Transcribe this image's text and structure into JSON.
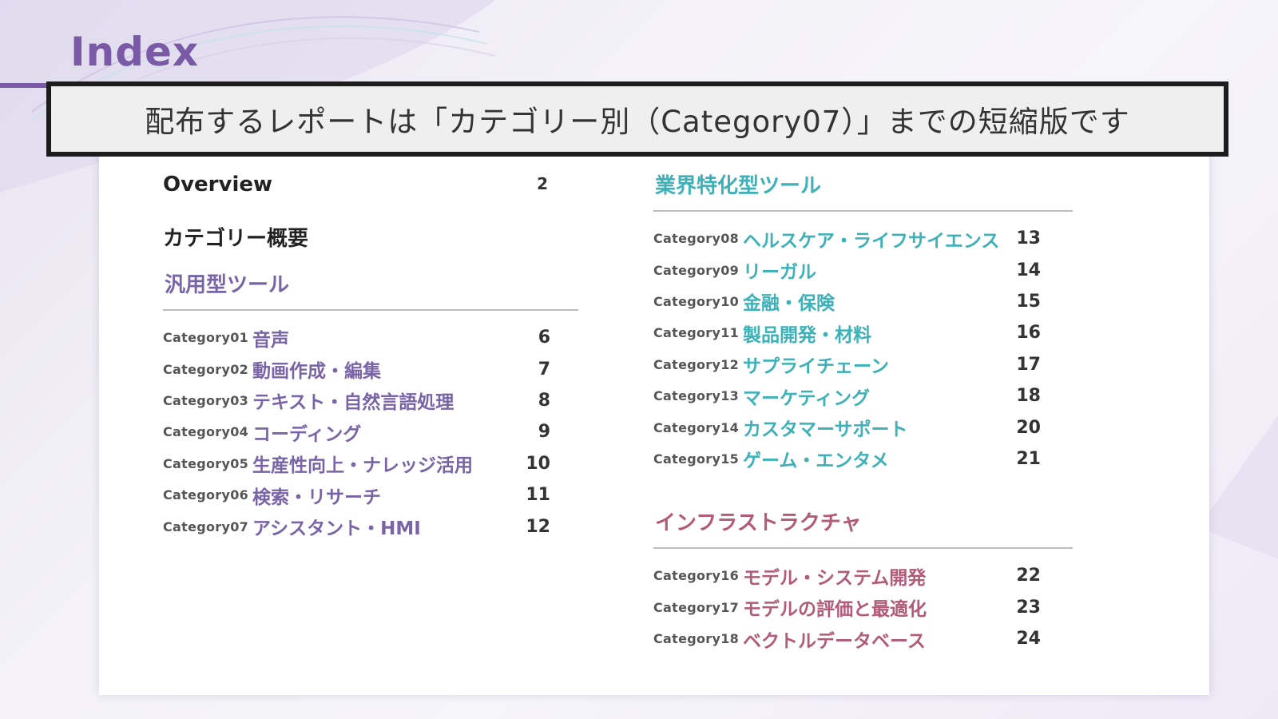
{
  "slide": {
    "title": "Index"
  },
  "notice": "配布するレポートは「カテゴリー別（Category07）」までの短縮版です",
  "colors": {
    "title": "#7a5aa6",
    "general": "#7a64a8",
    "industry": "#3db1b8",
    "infrastructure": "#b25a78"
  },
  "toc": {
    "overview": {
      "label": "Overview",
      "page": "2"
    },
    "summary": {
      "label": "カテゴリー概要"
    },
    "general": {
      "heading": "汎用型ツール",
      "items": [
        {
          "cat": "Category01",
          "label": "音声",
          "page": "6"
        },
        {
          "cat": "Category02",
          "label": "動画作成・編集",
          "page": "7"
        },
        {
          "cat": "Category03",
          "label": "テキスト・自然言語処理",
          "page": "8"
        },
        {
          "cat": "Category04",
          "label": "コーディング",
          "page": "9"
        },
        {
          "cat": "Category05",
          "label": "生産性向上・ナレッジ活用",
          "page": "10"
        },
        {
          "cat": "Category06",
          "label": "検索・リサーチ",
          "page": "11"
        },
        {
          "cat": "Category07",
          "label": "アシスタント・HMI",
          "page": "12"
        }
      ]
    },
    "industry": {
      "heading": "業界特化型ツール",
      "items": [
        {
          "cat": "Category08",
          "label": "ヘルスケア・ライフサイエンス",
          "page": "13"
        },
        {
          "cat": "Category09",
          "label": "リーガル",
          "page": "14"
        },
        {
          "cat": "Category10",
          "label": "金融・保険",
          "page": "15"
        },
        {
          "cat": "Category11",
          "label": "製品開発・材料",
          "page": "16"
        },
        {
          "cat": "Category12",
          "label": "サプライチェーン",
          "page": "17"
        },
        {
          "cat": "Category13",
          "label": "マーケティング",
          "page": "18"
        },
        {
          "cat": "Category14",
          "label": "カスタマーサポート",
          "page": "20"
        },
        {
          "cat": "Category15",
          "label": "ゲーム・エンタメ",
          "page": "21"
        }
      ]
    },
    "infrastructure": {
      "heading": "インフラストラクチャ",
      "items": [
        {
          "cat": "Category16",
          "label": "モデル・システム開発",
          "page": "22"
        },
        {
          "cat": "Category17",
          "label": "モデルの評価と最適化",
          "page": "23"
        },
        {
          "cat": "Category18",
          "label": "ベクトルデータベース",
          "page": "24"
        }
      ]
    }
  }
}
